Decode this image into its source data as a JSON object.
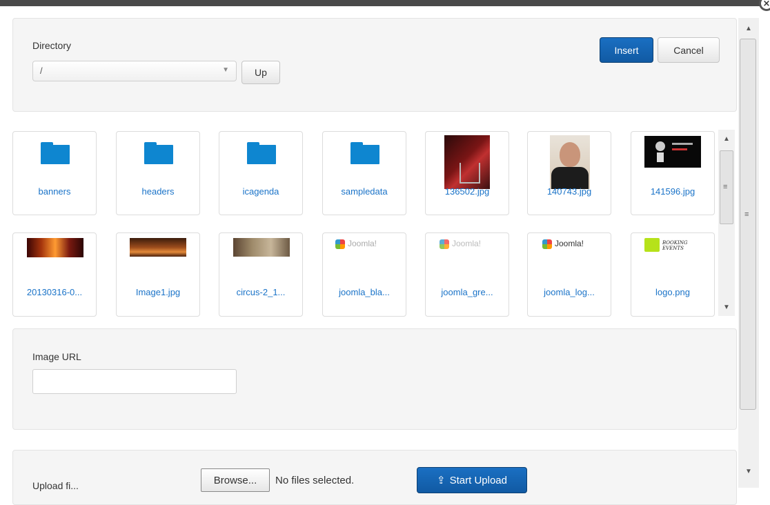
{
  "close_glyph": "×",
  "toolbar": {
    "directory_label": "Directory",
    "directory_value": "/",
    "up_label": "Up",
    "insert_label": "Insert",
    "cancel_label": "Cancel"
  },
  "files": [
    {
      "name": "banners",
      "kind": "folder"
    },
    {
      "name": "headers",
      "kind": "folder"
    },
    {
      "name": "icagenda",
      "kind": "folder"
    },
    {
      "name": "sampledata",
      "kind": "folder"
    },
    {
      "name": "136502.jpg",
      "kind": "image"
    },
    {
      "name": "140743.jpg",
      "kind": "image"
    },
    {
      "name": "141596.jpg",
      "kind": "image"
    },
    {
      "name": "20130316-0...",
      "kind": "image"
    },
    {
      "name": "Image1.jpg",
      "kind": "image"
    },
    {
      "name": "circus-2_1...",
      "kind": "image"
    },
    {
      "name": "joomla_bla...",
      "kind": "image"
    },
    {
      "name": "joomla_gre...",
      "kind": "image"
    },
    {
      "name": "joomla_log...",
      "kind": "image"
    },
    {
      "name": "logo.png",
      "kind": "image"
    }
  ],
  "thumb_text": {
    "joomla": "Joomla!",
    "logo": "BOOKING EVENTS"
  },
  "url_section": {
    "label": "Image URL",
    "value": ""
  },
  "upload": {
    "label": "Upload fi...",
    "browse_label": "Browse...",
    "no_files": "No files selected.",
    "start_label": "Start Upload",
    "start_icon": "upload-icon"
  },
  "colors": {
    "link": "#1a73c8",
    "primary": "#115aa3",
    "folder": "#0e86d0"
  }
}
